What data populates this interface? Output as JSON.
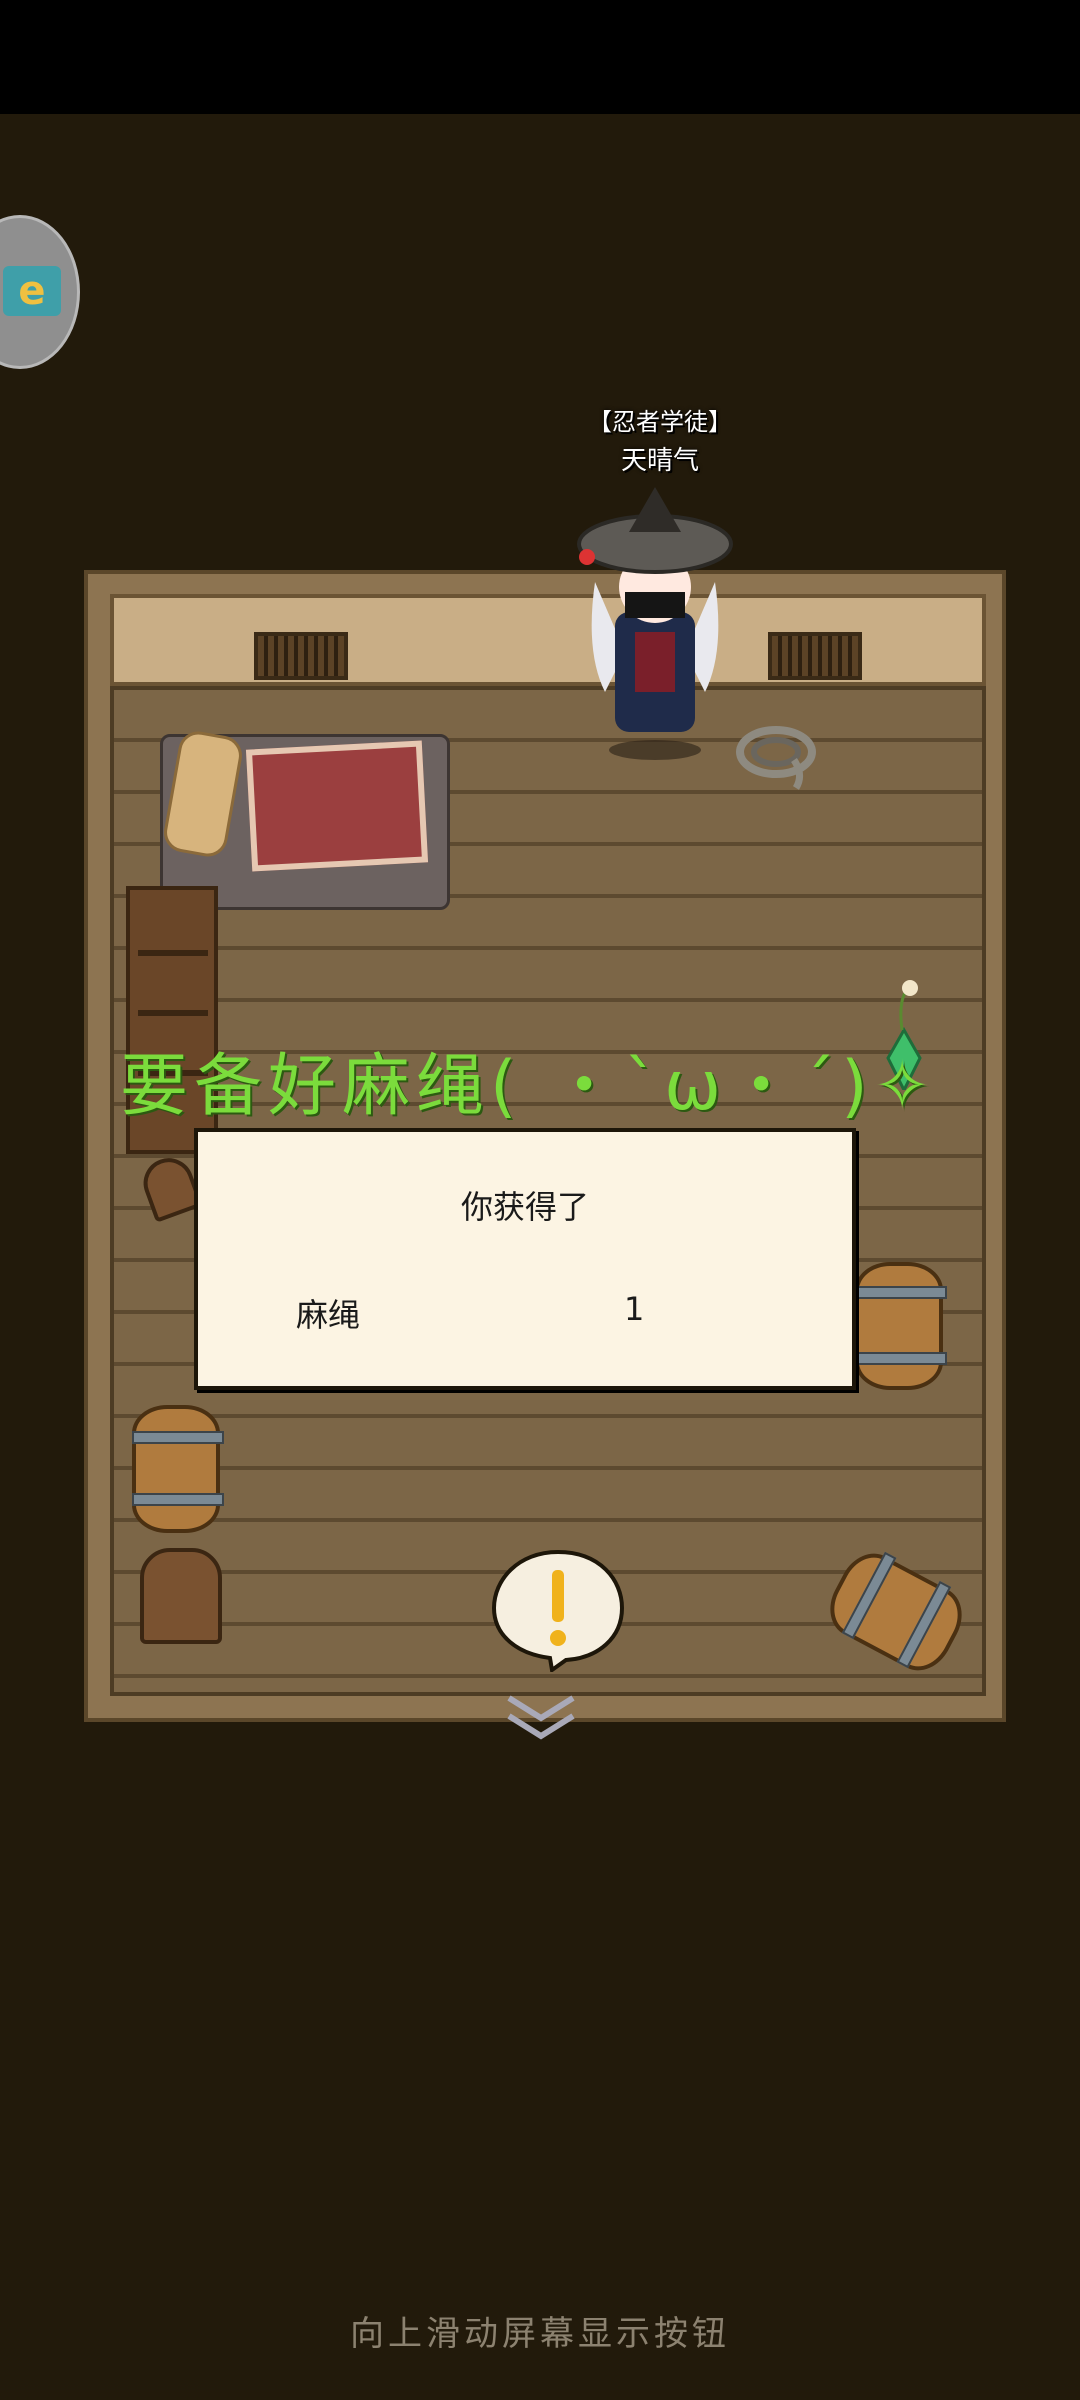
{
  "player": {
    "title": "【忍者学徒】",
    "name": "天晴气"
  },
  "floating_message": "要备好麻绳( ・`ω・´)✧",
  "reward_dialog": {
    "title": "你获得了",
    "item_name": "麻绳",
    "item_quantity": "1"
  },
  "app_badge_icon": "app-badge-icon",
  "speech_bubble": {
    "symbol": "!"
  },
  "footer_hint": "向上滑动屏幕显示按钮",
  "colors": {
    "background": "#221a0b",
    "floating_text": "#7bdc3c",
    "dialog_bg": "#fcf4e3"
  }
}
